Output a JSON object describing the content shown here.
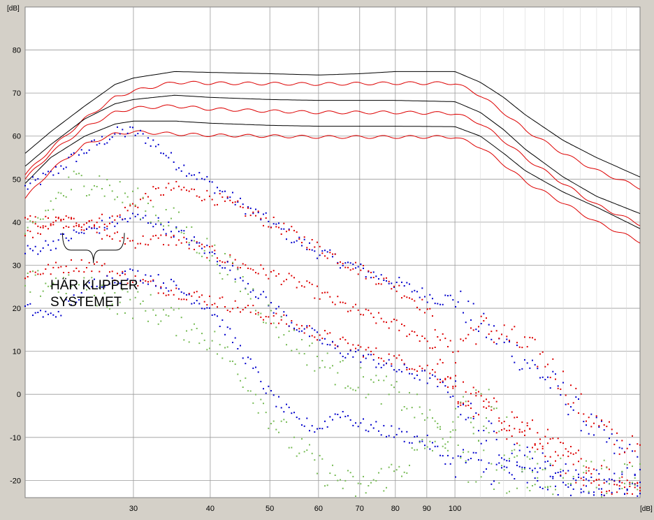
{
  "chart_data": {
    "type": "scatter",
    "title": "",
    "xlabel": "",
    "ylabel": "",
    "y_unit": "[dB]",
    "x_unit": "[dB]",
    "x_scale": "log",
    "xlim": [
      20,
      200
    ],
    "ylim": [
      -24,
      90
    ],
    "grid": true,
    "x_ticks": [
      30,
      40,
      50,
      60,
      70,
      80,
      90,
      100
    ],
    "y_ticks": [
      -20,
      -10,
      0,
      10,
      20,
      30,
      40,
      50,
      60,
      70,
      80
    ],
    "annotation": {
      "lines": [
        "HÄR KLIPPER",
        "SYSTEMET"
      ],
      "bracket_x": [
        23,
        29
      ]
    },
    "colors": {
      "plot_bg": "#ffffff",
      "grid": "#9a9a9a",
      "frame_bg": "#d4d0c8",
      "black": "#000000",
      "red": "#dd0000",
      "blue": "#0000cc",
      "green": "#77bb55"
    },
    "series": [
      {
        "color": "black",
        "style": "line",
        "x": [
          20,
          22,
          25,
          28,
          30,
          35,
          40,
          50,
          60,
          70,
          80,
          100,
          110,
          120,
          130,
          150,
          170,
          200
        ],
        "y": [
          56,
          61,
          67,
          72,
          73.5,
          75,
          74.8,
          74.5,
          74.2,
          74.5,
          75,
          75,
          72.5,
          69,
          65,
          59,
          55,
          50.5
        ]
      },
      {
        "color": "red",
        "style": "line",
        "x": [
          20,
          22,
          25,
          28,
          30,
          35,
          40,
          50,
          60,
          70,
          80,
          100,
          110,
          120,
          130,
          150,
          170,
          200
        ],
        "y": [
          51,
          57,
          64,
          69,
          70.5,
          72.5,
          72.3,
          72.2,
          72.1,
          72.2,
          72.3,
          72.3,
          69.5,
          65.5,
          61.5,
          56,
          52,
          48
        ]
      },
      {
        "color": "black",
        "style": "line",
        "x": [
          20,
          22,
          25,
          28,
          30,
          35,
          40,
          50,
          60,
          70,
          80,
          100,
          110,
          120,
          130,
          150,
          170,
          200
        ],
        "y": [
          53,
          58,
          64,
          67.5,
          68.5,
          69.5,
          69,
          68.5,
          68.3,
          68.3,
          68.3,
          68,
          65.5,
          61.5,
          57,
          50.5,
          46,
          42
        ]
      },
      {
        "color": "red",
        "style": "line",
        "x": [
          20,
          22,
          25,
          28,
          30,
          35,
          40,
          50,
          60,
          70,
          80,
          100,
          110,
          120,
          130,
          150,
          170,
          200
        ],
        "y": [
          50,
          56,
          62,
          65.5,
          66.5,
          67,
          66.3,
          65.8,
          65.5,
          65.5,
          65.5,
          65.3,
          63,
          59,
          55,
          49,
          44,
          39.5
        ]
      },
      {
        "color": "black",
        "style": "line",
        "x": [
          20,
          22,
          25,
          28,
          30,
          35,
          40,
          50,
          60,
          70,
          80,
          100,
          110,
          120,
          130,
          150,
          170,
          200
        ],
        "y": [
          49,
          55,
          60,
          62.8,
          63.5,
          63.5,
          63,
          62.5,
          62.3,
          62.3,
          62.3,
          62.2,
          60,
          56,
          52,
          47,
          43.5,
          38.5
        ]
      },
      {
        "color": "red",
        "style": "line",
        "x": [
          20,
          22,
          25,
          28,
          30,
          35,
          40,
          50,
          60,
          70,
          80,
          100,
          110,
          120,
          130,
          150,
          170,
          200
        ],
        "y": [
          45.5,
          52,
          58,
          60.5,
          61,
          60.5,
          60.2,
          60,
          59.8,
          59.8,
          59.8,
          59.8,
          57.5,
          53.5,
          49.5,
          44.5,
          40,
          35.5
        ]
      },
      {
        "color": "blue",
        "style": "dots",
        "x": [
          20,
          22,
          24,
          26,
          28,
          30,
          32,
          35,
          40,
          45,
          50,
          55,
          60,
          65,
          70,
          80,
          90,
          95,
          100,
          105,
          110,
          120,
          130,
          140,
          150,
          160,
          180,
          200
        ],
        "y": [
          48,
          51,
          55,
          58,
          60.5,
          61,
          59,
          54,
          49,
          44,
          40,
          36,
          33,
          31,
          29,
          26,
          23,
          22,
          22.5,
          19,
          16,
          12,
          8,
          4,
          0,
          -5,
          -12,
          -16
        ]
      },
      {
        "color": "red",
        "style": "dots",
        "x": [
          20,
          22,
          24,
          26,
          28,
          30,
          32,
          35,
          40,
          45,
          50,
          55,
          60,
          65,
          70,
          80,
          90,
          95,
          100,
          105,
          110,
          120,
          130,
          140,
          150,
          160,
          180,
          200
        ],
        "y": [
          40,
          40,
          40,
          40.5,
          40.5,
          44,
          46.5,
          48,
          46,
          43,
          40,
          37,
          34,
          31.5,
          29,
          25,
          20,
          13,
          10,
          14,
          15.5,
          14,
          11,
          8,
          3,
          -3,
          -10,
          -14
        ]
      },
      {
        "color": "red",
        "style": "dots",
        "x": [
          20,
          22,
          24,
          26,
          28,
          30,
          32,
          35,
          40,
          45,
          50,
          55,
          60,
          65,
          70,
          80,
          90,
          95,
          100,
          105,
          110,
          120,
          130,
          140,
          150,
          160,
          180,
          200
        ],
        "y": [
          37,
          40,
          40.5,
          38,
          36.5,
          35.5,
          35.8,
          36,
          33,
          30,
          28,
          26,
          23.5,
          21,
          19,
          16,
          13,
          7,
          0,
          -2,
          -3,
          -5,
          -8,
          -11,
          -14,
          -16,
          -20,
          -22
        ]
      },
      {
        "color": "red",
        "style": "dots",
        "x": [
          20,
          22,
          24,
          26,
          28,
          30,
          32,
          35,
          40,
          45,
          50,
          55,
          60,
          65,
          70,
          80,
          90,
          95,
          100,
          105,
          110,
          120,
          130,
          140,
          150,
          160,
          180,
          200
        ],
        "y": [
          28,
          29,
          30,
          30,
          28,
          26.5,
          25.5,
          24,
          22,
          20,
          18,
          16,
          14,
          12,
          10.5,
          8,
          6,
          4,
          2,
          -1,
          -3,
          -7,
          -10,
          -13,
          -16,
          -18,
          -21,
          -22
        ]
      },
      {
        "color": "blue",
        "style": "dots",
        "x": [
          20,
          22,
          24,
          26,
          28,
          30,
          32,
          35,
          40,
          45,
          50,
          55,
          60,
          65,
          70,
          80,
          90,
          95,
          100,
          105,
          110,
          120,
          130,
          140,
          150,
          160,
          180,
          200
        ],
        "y": [
          33,
          35,
          37,
          38.5,
          40,
          41,
          40.5,
          38,
          33,
          27,
          21,
          16,
          13,
          10,
          9,
          6,
          4,
          2,
          0,
          -4,
          -8,
          -12,
          -15,
          -17,
          -19,
          -20,
          -21,
          -22
        ]
      },
      {
        "color": "blue",
        "style": "dots",
        "x": [
          20,
          22,
          24,
          26,
          28,
          30,
          32,
          35,
          40,
          45,
          50,
          55,
          60,
          65,
          70,
          80,
          90,
          95,
          100,
          105,
          110,
          120,
          130,
          140,
          150,
          160,
          180,
          200
        ],
        "y": [
          20,
          18,
          22,
          26,
          27,
          28,
          27,
          25,
          20,
          10,
          0,
          -6,
          -8,
          -4,
          -7,
          -9,
          -11,
          -14,
          -16,
          -15,
          -17,
          -18,
          -19,
          -20,
          -20,
          -21,
          -22,
          -22
        ]
      },
      {
        "color": "green",
        "style": "dots",
        "x": [
          20,
          22,
          24,
          26,
          28,
          30,
          32,
          35,
          40,
          45,
          50,
          55,
          60,
          65,
          70,
          80,
          90,
          95,
          100,
          105,
          110,
          120,
          130,
          140,
          150,
          160,
          180,
          200
        ],
        "y": [
          35,
          44,
          49,
          50,
          47,
          45,
          43,
          40,
          33,
          26,
          18,
          12,
          8,
          5,
          3,
          0,
          -5,
          -9,
          -12,
          -13,
          -14,
          -18,
          -20,
          -21,
          -22,
          -23,
          -23,
          -23
        ]
      },
      {
        "color": "green",
        "style": "dots",
        "x": [
          20,
          22,
          24,
          26,
          28,
          30,
          32,
          35,
          40,
          45,
          50,
          55,
          60,
          65,
          70,
          80,
          90,
          95,
          100,
          105,
          110,
          120,
          130,
          140,
          150,
          160,
          180,
          200
        ],
        "y": [
          25,
          26,
          24,
          24,
          22,
          21,
          20,
          17,
          13,
          5,
          -5,
          -12,
          -17,
          -20,
          -22,
          -18,
          -12,
          -10,
          -9,
          -6,
          -4,
          -10,
          -17,
          -21,
          -23,
          -23,
          -23,
          -23
        ]
      }
    ]
  }
}
